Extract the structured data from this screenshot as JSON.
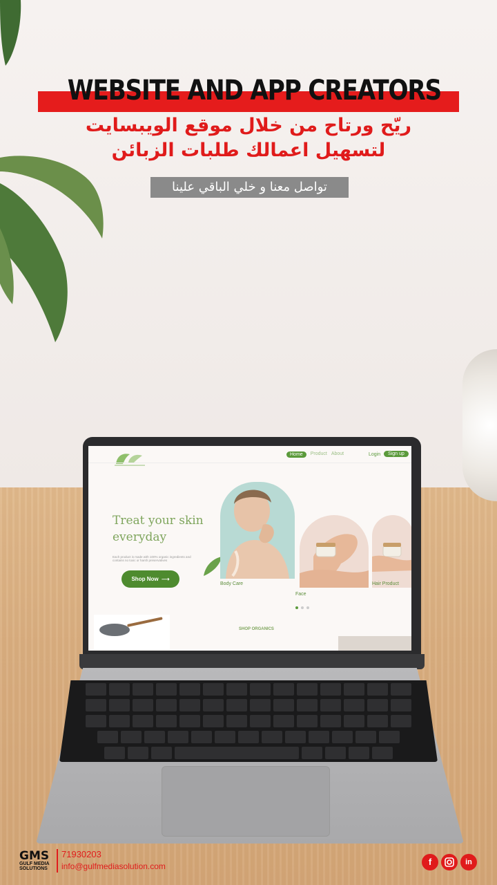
{
  "ad": {
    "headline": "WEBSITE AND APP CREATORS",
    "arabic_line1": "ريّح ورتاح من خلال موقع الويبسايت",
    "arabic_line2": "لتسهيل اعمالك طلبات الزبائن",
    "contact_cta": "تواصل معنا و خلي الباقي علينا"
  },
  "website": {
    "nav": [
      "Home",
      "Product",
      "About"
    ],
    "login": "Login",
    "signup": "Sign up",
    "hero_title": "Treat your skin everyday",
    "hero_desc": "Each product is made with 100% organic ingredients and contains no toxic or harsh preservatives",
    "shop_button": "Shop Now",
    "categories": [
      "Body Care",
      "Face",
      "Hair Product"
    ],
    "section_title": "SHOP ORGANICS"
  },
  "footer": {
    "brand": "GMS",
    "brand_sub": "GULF MEDIA SOLUTIONS",
    "phone": "71930203",
    "email": "info@gulfmediasolution.com"
  },
  "icons": {
    "social": [
      "facebook-icon",
      "instagram-icon",
      "linkedin-icon"
    ]
  },
  "colors": {
    "accent_red": "#e51c1c",
    "brand_green": "#5b9a3b"
  }
}
